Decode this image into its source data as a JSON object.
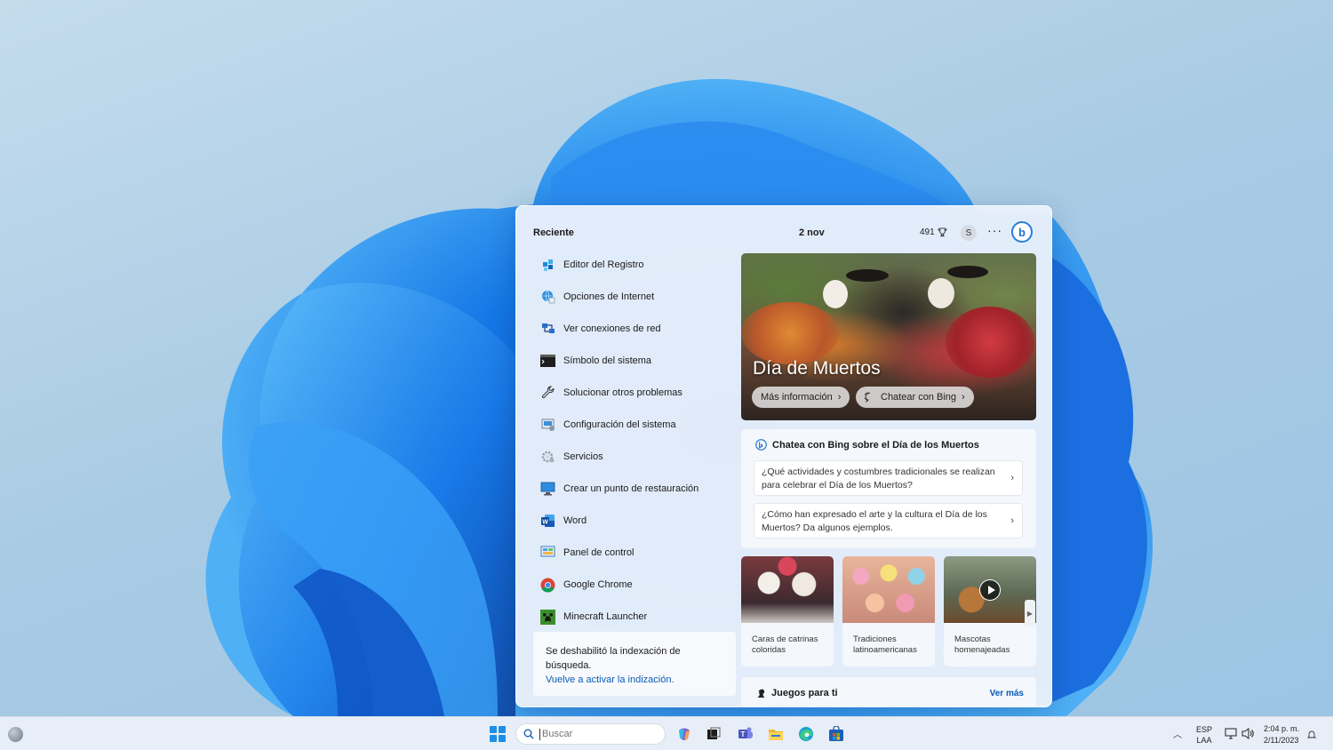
{
  "panel": {
    "recent_title": "Reciente",
    "date": "2 nov",
    "points": "491",
    "avatar_initial": "S",
    "more": "···",
    "bing_letter": "b"
  },
  "recent_items": [
    {
      "label": "Editor del Registro",
      "icon": "registry-editor-icon"
    },
    {
      "label": "Opciones de Internet",
      "icon": "internet-options-icon"
    },
    {
      "label": "Ver conexiones de red",
      "icon": "network-connections-icon"
    },
    {
      "label": "Símbolo del sistema",
      "icon": "command-prompt-icon"
    },
    {
      "label": "Solucionar otros problemas",
      "icon": "wrench-icon"
    },
    {
      "label": "Configuración del sistema",
      "icon": "system-configuration-icon"
    },
    {
      "label": "Servicios",
      "icon": "services-gear-icon"
    },
    {
      "label": "Crear un punto de restauración",
      "icon": "restore-point-icon"
    },
    {
      "label": "Word",
      "icon": "word-icon"
    },
    {
      "label": "Panel de control",
      "icon": "control-panel-icon"
    },
    {
      "label": "Google Chrome",
      "icon": "chrome-icon"
    },
    {
      "label": "Minecraft Launcher",
      "icon": "minecraft-icon"
    }
  ],
  "indexing": {
    "message": "Se deshabilitó la indexación de búsqueda.",
    "link": "Vuelve a activar la indización."
  },
  "hero": {
    "title": "Día de Muertos",
    "more_info": "Más información",
    "chat_bing": "Chatear con Bing"
  },
  "chat": {
    "title": "Chatea con Bing sobre el Día de los Muertos",
    "questions": [
      "¿Qué actividades y costumbres tradicionales se realizan para celebrar el Día de los Muertos?",
      "¿Cómo han expresado el arte y la cultura el Día de los Muertos? Da algunos ejemplos."
    ]
  },
  "tiles": [
    {
      "caption": "Caras de catrinas coloridas"
    },
    {
      "caption": "Tradiciones latinoamericanas"
    },
    {
      "caption": "Mascotas homenajeadas"
    }
  ],
  "games": {
    "title": "Juegos para ti",
    "more": "Ver más"
  },
  "taskbar": {
    "search_placeholder": "Buscar",
    "lang_top": "ESP",
    "lang_bottom": "LAA",
    "time": "2:04 p. m.",
    "date": "2/11/2023",
    "apps": [
      "copilot-icon",
      "task-view-icon",
      "teams-icon",
      "file-explorer-icon",
      "edge-icon",
      "store-icon"
    ]
  },
  "colors": {
    "accent": "#0a5bb8",
    "wallpaper_bloom": "#1a73e8"
  }
}
